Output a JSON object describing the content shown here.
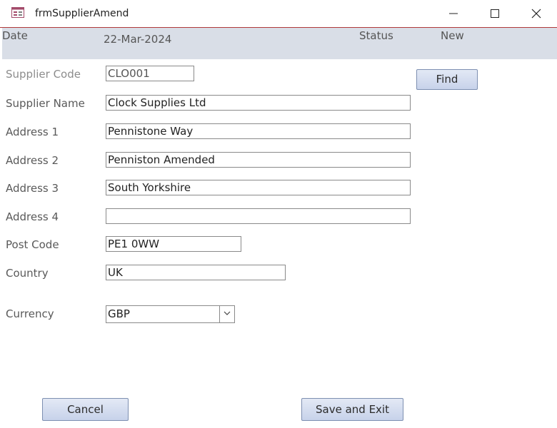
{
  "window": {
    "title": "frmSupplierAmend",
    "icons": [
      "form-icon",
      "minimize-icon",
      "maximize-icon",
      "close-icon"
    ]
  },
  "header": {
    "date_label": "Date",
    "date_value": "22-Mar-2024",
    "status_label": "Status",
    "status_value": "New"
  },
  "form": {
    "supplier_code": {
      "label": "Supplier Code",
      "value": "CLO001"
    },
    "supplier_name": {
      "label": "Supplier Name",
      "value": "Clock Supplies Ltd"
    },
    "address1": {
      "label": "Address 1",
      "value": "Pennistone Way"
    },
    "address2": {
      "label": "Address 2",
      "value": "Penniston Amended"
    },
    "address3": {
      "label": "Address 3",
      "value": "South Yorkshire"
    },
    "address4": {
      "label": "Address 4",
      "value": ""
    },
    "post_code": {
      "label": "Post Code",
      "value": "PE1 0WW"
    },
    "country": {
      "label": "Country",
      "value": "UK"
    },
    "currency": {
      "label": "Currency",
      "value": "GBP"
    }
  },
  "buttons": {
    "find": "Find",
    "cancel": "Cancel",
    "save_exit": "Save and Exit"
  },
  "colors": {
    "header_bg": "#d9dee7",
    "title_border": "#b03a3a",
    "button_bg": "#d3dcef",
    "button_border": "#7d8fb1"
  }
}
